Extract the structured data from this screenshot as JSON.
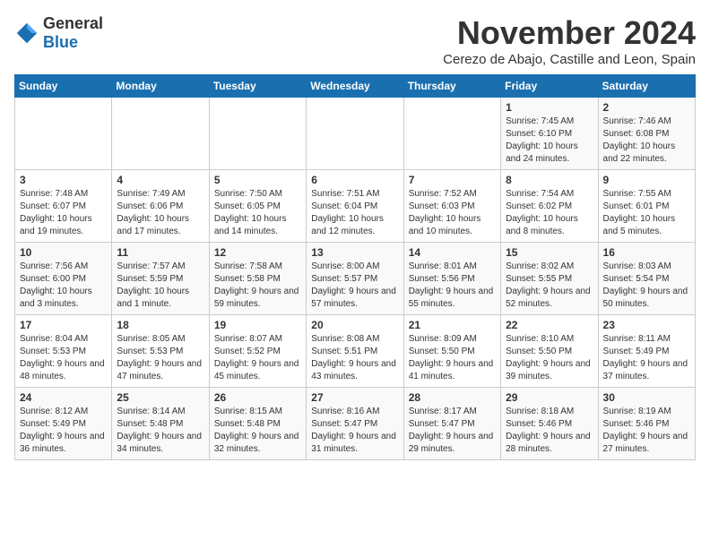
{
  "logo": {
    "general": "General",
    "blue": "Blue"
  },
  "title": "November 2024",
  "subtitle": "Cerezo de Abajo, Castille and Leon, Spain",
  "days_header": [
    "Sunday",
    "Monday",
    "Tuesday",
    "Wednesday",
    "Thursday",
    "Friday",
    "Saturday"
  ],
  "weeks": [
    [
      {
        "day": "",
        "text": ""
      },
      {
        "day": "",
        "text": ""
      },
      {
        "day": "",
        "text": ""
      },
      {
        "day": "",
        "text": ""
      },
      {
        "day": "",
        "text": ""
      },
      {
        "day": "1",
        "text": "Sunrise: 7:45 AM\nSunset: 6:10 PM\nDaylight: 10 hours and 24 minutes."
      },
      {
        "day": "2",
        "text": "Sunrise: 7:46 AM\nSunset: 6:08 PM\nDaylight: 10 hours and 22 minutes."
      }
    ],
    [
      {
        "day": "3",
        "text": "Sunrise: 7:48 AM\nSunset: 6:07 PM\nDaylight: 10 hours and 19 minutes."
      },
      {
        "day": "4",
        "text": "Sunrise: 7:49 AM\nSunset: 6:06 PM\nDaylight: 10 hours and 17 minutes."
      },
      {
        "day": "5",
        "text": "Sunrise: 7:50 AM\nSunset: 6:05 PM\nDaylight: 10 hours and 14 minutes."
      },
      {
        "day": "6",
        "text": "Sunrise: 7:51 AM\nSunset: 6:04 PM\nDaylight: 10 hours and 12 minutes."
      },
      {
        "day": "7",
        "text": "Sunrise: 7:52 AM\nSunset: 6:03 PM\nDaylight: 10 hours and 10 minutes."
      },
      {
        "day": "8",
        "text": "Sunrise: 7:54 AM\nSunset: 6:02 PM\nDaylight: 10 hours and 8 minutes."
      },
      {
        "day": "9",
        "text": "Sunrise: 7:55 AM\nSunset: 6:01 PM\nDaylight: 10 hours and 5 minutes."
      }
    ],
    [
      {
        "day": "10",
        "text": "Sunrise: 7:56 AM\nSunset: 6:00 PM\nDaylight: 10 hours and 3 minutes."
      },
      {
        "day": "11",
        "text": "Sunrise: 7:57 AM\nSunset: 5:59 PM\nDaylight: 10 hours and 1 minute."
      },
      {
        "day": "12",
        "text": "Sunrise: 7:58 AM\nSunset: 5:58 PM\nDaylight: 9 hours and 59 minutes."
      },
      {
        "day": "13",
        "text": "Sunrise: 8:00 AM\nSunset: 5:57 PM\nDaylight: 9 hours and 57 minutes."
      },
      {
        "day": "14",
        "text": "Sunrise: 8:01 AM\nSunset: 5:56 PM\nDaylight: 9 hours and 55 minutes."
      },
      {
        "day": "15",
        "text": "Sunrise: 8:02 AM\nSunset: 5:55 PM\nDaylight: 9 hours and 52 minutes."
      },
      {
        "day": "16",
        "text": "Sunrise: 8:03 AM\nSunset: 5:54 PM\nDaylight: 9 hours and 50 minutes."
      }
    ],
    [
      {
        "day": "17",
        "text": "Sunrise: 8:04 AM\nSunset: 5:53 PM\nDaylight: 9 hours and 48 minutes."
      },
      {
        "day": "18",
        "text": "Sunrise: 8:05 AM\nSunset: 5:53 PM\nDaylight: 9 hours and 47 minutes."
      },
      {
        "day": "19",
        "text": "Sunrise: 8:07 AM\nSunset: 5:52 PM\nDaylight: 9 hours and 45 minutes."
      },
      {
        "day": "20",
        "text": "Sunrise: 8:08 AM\nSunset: 5:51 PM\nDaylight: 9 hours and 43 minutes."
      },
      {
        "day": "21",
        "text": "Sunrise: 8:09 AM\nSunset: 5:50 PM\nDaylight: 9 hours and 41 minutes."
      },
      {
        "day": "22",
        "text": "Sunrise: 8:10 AM\nSunset: 5:50 PM\nDaylight: 9 hours and 39 minutes."
      },
      {
        "day": "23",
        "text": "Sunrise: 8:11 AM\nSunset: 5:49 PM\nDaylight: 9 hours and 37 minutes."
      }
    ],
    [
      {
        "day": "24",
        "text": "Sunrise: 8:12 AM\nSunset: 5:49 PM\nDaylight: 9 hours and 36 minutes."
      },
      {
        "day": "25",
        "text": "Sunrise: 8:14 AM\nSunset: 5:48 PM\nDaylight: 9 hours and 34 minutes."
      },
      {
        "day": "26",
        "text": "Sunrise: 8:15 AM\nSunset: 5:48 PM\nDaylight: 9 hours and 32 minutes."
      },
      {
        "day": "27",
        "text": "Sunrise: 8:16 AM\nSunset: 5:47 PM\nDaylight: 9 hours and 31 minutes."
      },
      {
        "day": "28",
        "text": "Sunrise: 8:17 AM\nSunset: 5:47 PM\nDaylight: 9 hours and 29 minutes."
      },
      {
        "day": "29",
        "text": "Sunrise: 8:18 AM\nSunset: 5:46 PM\nDaylight: 9 hours and 28 minutes."
      },
      {
        "day": "30",
        "text": "Sunrise: 8:19 AM\nSunset: 5:46 PM\nDaylight: 9 hours and 27 minutes."
      }
    ]
  ]
}
